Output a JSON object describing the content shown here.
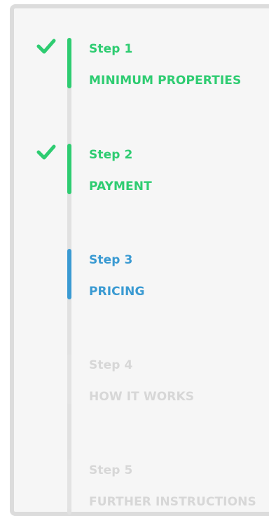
{
  "steps": [
    {
      "number": "Step 1",
      "title": "MINIMUM PROPERTIES",
      "status": "completed",
      "icon": "check-icon"
    },
    {
      "number": "Step 2",
      "title": "PAYMENT",
      "status": "completed",
      "icon": "check-icon"
    },
    {
      "number": "Step 3",
      "title": "PRICING",
      "status": "active",
      "icon": ""
    },
    {
      "number": "Step 4",
      "title": "HOW IT WORKS",
      "status": "pending",
      "icon": ""
    },
    {
      "number": "Step 5",
      "title": "FURTHER INSTRUCTIONS",
      "status": "pending",
      "icon": ""
    }
  ],
  "colors": {
    "completed": "#2ecc71",
    "active": "#3a9ad2",
    "pending": "#d7d7d7",
    "panel_background": "#f6f6f6",
    "panel_border": "#dcdcdc"
  }
}
